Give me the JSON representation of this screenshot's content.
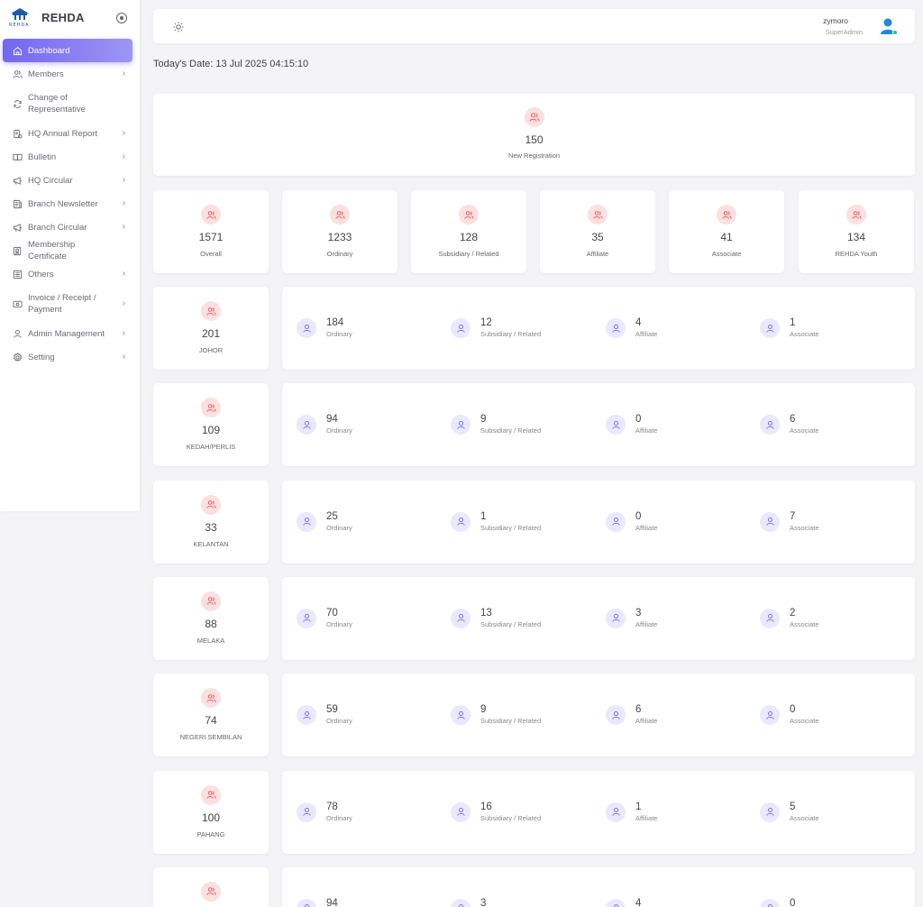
{
  "brand": {
    "name": "REHDA",
    "logo_text": "REHDA"
  },
  "nav": [
    {
      "label": "Dashboard",
      "icon": "home-icon",
      "active": true,
      "chevron": false
    },
    {
      "label": "Members",
      "icon": "users-icon",
      "chevron": true
    },
    {
      "label": "Change of Representative",
      "icon": "refresh-icon",
      "chevron": false
    },
    {
      "label": "HQ Annual Report",
      "icon": "report-icon",
      "chevron": true
    },
    {
      "label": "Bulletin",
      "icon": "book-icon",
      "chevron": true
    },
    {
      "label": "HQ Circular",
      "icon": "megaphone-icon",
      "chevron": true
    },
    {
      "label": "Branch Newsletter",
      "icon": "news-icon",
      "chevron": true
    },
    {
      "label": "Branch Circular",
      "icon": "megaphone-icon",
      "chevron": true
    },
    {
      "label": "Membership Certificate",
      "icon": "certificate-icon",
      "chevron": false
    },
    {
      "label": "Others",
      "icon": "list-icon",
      "chevron": true
    },
    {
      "label": "Invoice / Receipt / Payment",
      "icon": "invoice-icon",
      "chevron": true
    },
    {
      "label": "Admin Management",
      "icon": "user-icon",
      "chevron": true
    },
    {
      "label": "Setting",
      "icon": "gear-icon",
      "chevron": true
    }
  ],
  "topbar": {
    "user_name": "zymoro",
    "user_role": "SuperAdmin"
  },
  "date_line": "Today's Date: 13 Jul 2025 04:15:10",
  "new_registration": {
    "value": "150",
    "label": "New Registration"
  },
  "totals": [
    {
      "value": "1571",
      "label": "Overall"
    },
    {
      "value": "1233",
      "label": "Ordinary"
    },
    {
      "value": "128",
      "label": "Subsidiary / Related"
    },
    {
      "value": "35",
      "label": "Affiliate"
    },
    {
      "value": "41",
      "label": "Associate"
    },
    {
      "value": "134",
      "label": "REHDA Youth"
    }
  ],
  "breakdown_labels": [
    "Ordinary",
    "Subsidiary / Related",
    "Affiliate",
    "Associate"
  ],
  "branches": [
    {
      "name": "JOHOR",
      "total": "201",
      "values": [
        "184",
        "12",
        "4",
        "1"
      ]
    },
    {
      "name": "KEDAH/PERLIS",
      "total": "109",
      "values": [
        "94",
        "9",
        "0",
        "6"
      ]
    },
    {
      "name": "KELANTAN",
      "total": "33",
      "values": [
        "25",
        "1",
        "0",
        "7"
      ]
    },
    {
      "name": "MELAKA",
      "total": "88",
      "values": [
        "70",
        "13",
        "3",
        "2"
      ]
    },
    {
      "name": "NEGERI SEMBILAN",
      "total": "74",
      "values": [
        "59",
        "9",
        "6",
        "0"
      ]
    },
    {
      "name": "PAHANG",
      "total": "100",
      "values": [
        "78",
        "16",
        "1",
        "5"
      ]
    },
    {
      "name": "",
      "total": "",
      "values": [
        "94",
        "3",
        "4",
        "0"
      ]
    }
  ],
  "colors": {
    "accent": "#7367f0",
    "pink_bg": "#fbe0e0",
    "pink_icon": "#ea5455",
    "lavender_bg": "#eae8fd",
    "online": "#28c76f",
    "avatar": "#1e88e5"
  }
}
